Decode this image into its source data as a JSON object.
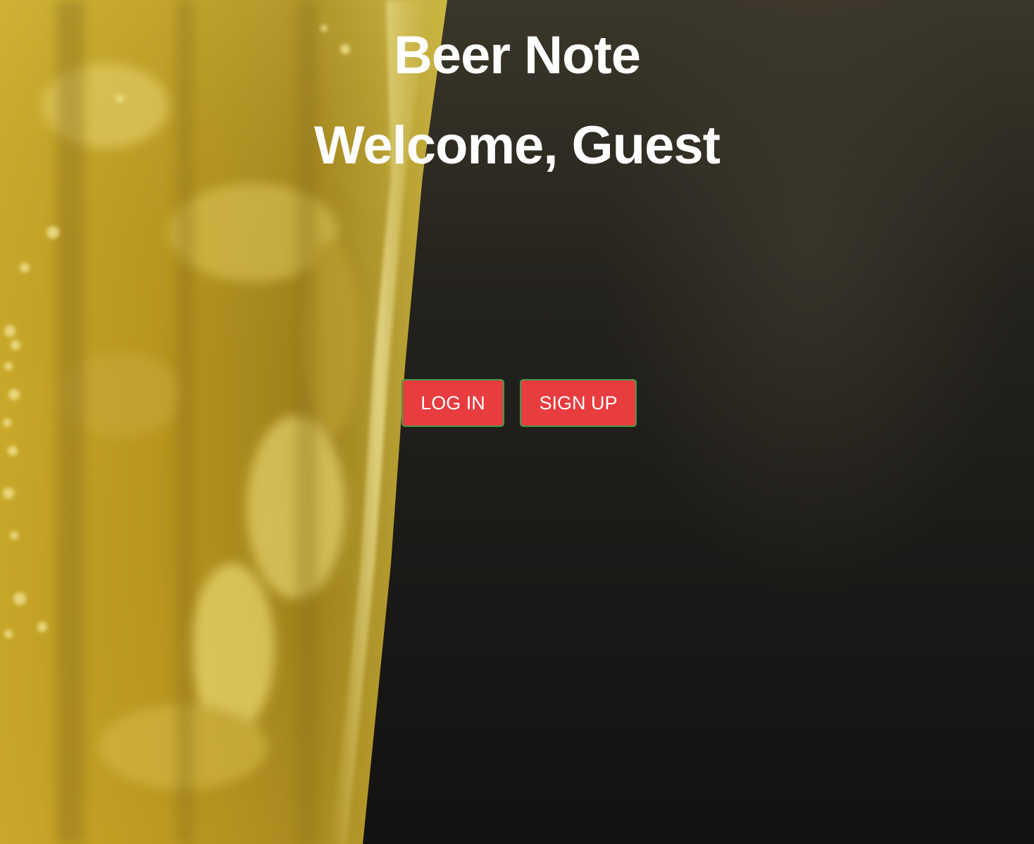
{
  "app": {
    "title": "Beer Note",
    "welcome": "Welcome, Guest"
  },
  "actions": {
    "login_label": "LOG IN",
    "signup_label": "SIGN UP"
  },
  "colors": {
    "button_bg": "#e83c3f",
    "button_border": "#3f9b4b",
    "text": "#ffffff"
  },
  "background": {
    "image": "beer-glass-photo"
  }
}
